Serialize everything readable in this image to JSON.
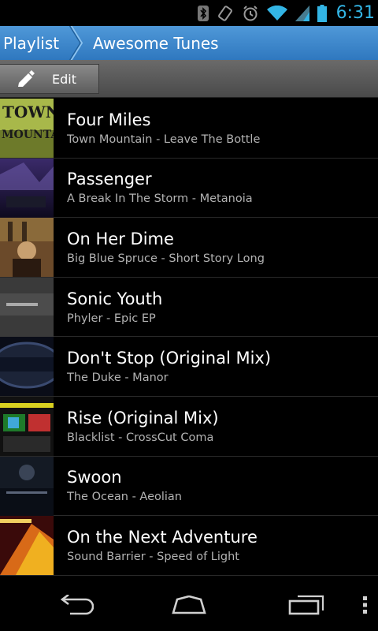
{
  "status_bar": {
    "time": "6:31",
    "icons": [
      "bluetooth-icon",
      "rotation-lock-icon",
      "alarm-icon",
      "wifi-icon",
      "cell-signal-icon",
      "battery-icon"
    ],
    "accent_color": "#33b5e5"
  },
  "breadcrumb": {
    "root": "Playlist",
    "current": "Awesome Tunes",
    "color": "#3b87cc"
  },
  "toolbar": {
    "edit_label": "Edit",
    "edit_icon": "pencil-icon"
  },
  "tracks": [
    {
      "title": "Four Miles",
      "subtitle": "Town Mountain - Leave The Bottle"
    },
    {
      "title": "Passenger",
      "subtitle": "A Break In The Storm - Metanoia"
    },
    {
      "title": "On Her Dime",
      "subtitle": "Big Blue Spruce - Short Story Long"
    },
    {
      "title": "Sonic Youth",
      "subtitle": "Phyler - Epic EP"
    },
    {
      "title": "Don't Stop (Original Mix)",
      "subtitle": "The Duke - Manor"
    },
    {
      "title": "Rise (Original Mix)",
      "subtitle": "Blacklist - CrossCut Coma"
    },
    {
      "title": "Swoon",
      "subtitle": "The Ocean - Aeolian"
    },
    {
      "title": "On the Next Adventure",
      "subtitle": "Sound Barrier - Speed of Light"
    }
  ],
  "nav_bar": {
    "icons": [
      "back-icon",
      "home-icon",
      "recent-apps-icon",
      "overflow-menu-icon"
    ]
  }
}
